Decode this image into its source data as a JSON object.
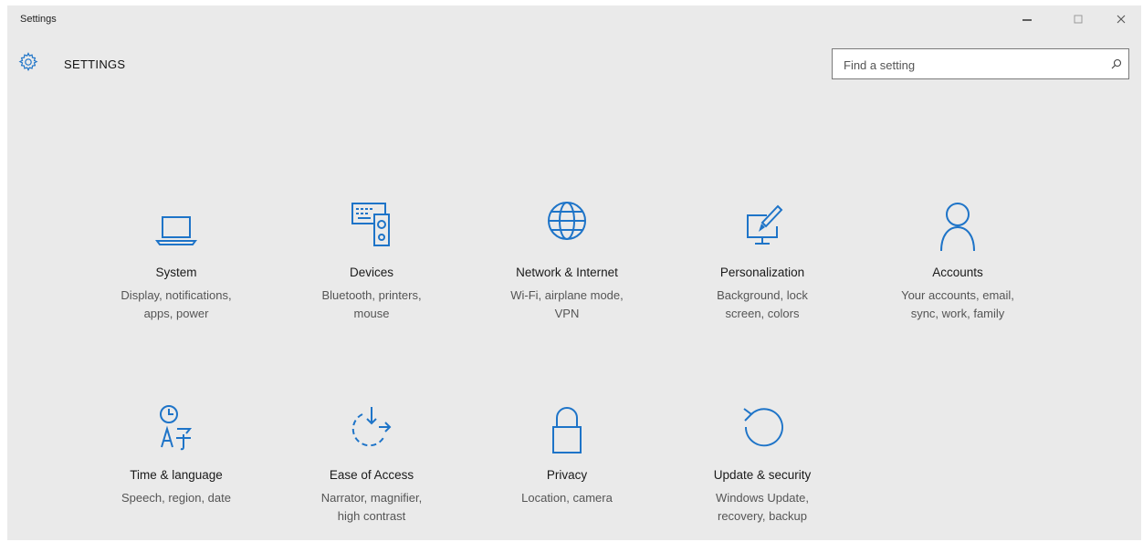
{
  "window": {
    "title": "Settings",
    "controls": {
      "minimize": "–",
      "maximize": "☐",
      "close": "✕"
    }
  },
  "header": {
    "title": "SETTINGS",
    "icon": "gear-icon"
  },
  "search": {
    "placeholder": "Find a setting",
    "icon": "search-icon"
  },
  "accent_color": "#1e74c8",
  "categories": [
    {
      "id": "system",
      "icon": "laptop-icon",
      "name": "System",
      "desc_line1": "Display, notifications,",
      "desc_line2": "apps, power"
    },
    {
      "id": "devices",
      "icon": "devices-icon",
      "name": "Devices",
      "desc_line1": "Bluetooth, printers,",
      "desc_line2": "mouse"
    },
    {
      "id": "network",
      "icon": "globe-icon",
      "name": "Network & Internet",
      "desc_line1": "Wi-Fi, airplane mode,",
      "desc_line2": "VPN"
    },
    {
      "id": "personalization",
      "icon": "paint-icon",
      "name": "Personalization",
      "desc_line1": "Background, lock",
      "desc_line2": "screen, colors"
    },
    {
      "id": "accounts",
      "icon": "person-icon",
      "name": "Accounts",
      "desc_line1": "Your accounts, email,",
      "desc_line2": "sync, work, family"
    },
    {
      "id": "time",
      "icon": "time-language-icon",
      "name": "Time & language",
      "desc_line1": "Speech, region, date",
      "desc_line2": ""
    },
    {
      "id": "ease",
      "icon": "ease-of-access-icon",
      "name": "Ease of Access",
      "desc_line1": "Narrator, magnifier,",
      "desc_line2": "high contrast"
    },
    {
      "id": "privacy",
      "icon": "lock-icon",
      "name": "Privacy",
      "desc_line1": "Location, camera",
      "desc_line2": ""
    },
    {
      "id": "update",
      "icon": "update-icon",
      "name": "Update & security",
      "desc_line1": "Windows Update,",
      "desc_line2": "recovery, backup"
    }
  ]
}
